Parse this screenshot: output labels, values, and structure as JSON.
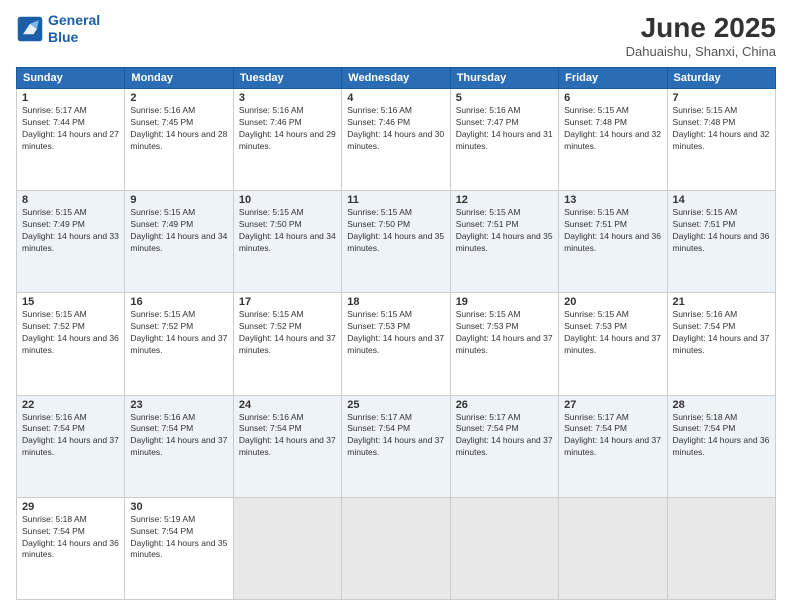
{
  "header": {
    "logo_line1": "General",
    "logo_line2": "Blue",
    "month_title": "June 2025",
    "location": "Dahuaishu, Shanxi, China"
  },
  "days_of_week": [
    "Sunday",
    "Monday",
    "Tuesday",
    "Wednesday",
    "Thursday",
    "Friday",
    "Saturday"
  ],
  "weeks": [
    [
      {
        "day": "1",
        "sunrise": "5:17 AM",
        "sunset": "7:44 PM",
        "daylight": "14 hours and 27 minutes."
      },
      {
        "day": "2",
        "sunrise": "5:16 AM",
        "sunset": "7:45 PM",
        "daylight": "14 hours and 28 minutes."
      },
      {
        "day": "3",
        "sunrise": "5:16 AM",
        "sunset": "7:46 PM",
        "daylight": "14 hours and 29 minutes."
      },
      {
        "day": "4",
        "sunrise": "5:16 AM",
        "sunset": "7:46 PM",
        "daylight": "14 hours and 30 minutes."
      },
      {
        "day": "5",
        "sunrise": "5:16 AM",
        "sunset": "7:47 PM",
        "daylight": "14 hours and 31 minutes."
      },
      {
        "day": "6",
        "sunrise": "5:15 AM",
        "sunset": "7:48 PM",
        "daylight": "14 hours and 32 minutes."
      },
      {
        "day": "7",
        "sunrise": "5:15 AM",
        "sunset": "7:48 PM",
        "daylight": "14 hours and 32 minutes."
      }
    ],
    [
      {
        "day": "8",
        "sunrise": "5:15 AM",
        "sunset": "7:49 PM",
        "daylight": "14 hours and 33 minutes."
      },
      {
        "day": "9",
        "sunrise": "5:15 AM",
        "sunset": "7:49 PM",
        "daylight": "14 hours and 34 minutes."
      },
      {
        "day": "10",
        "sunrise": "5:15 AM",
        "sunset": "7:50 PM",
        "daylight": "14 hours and 34 minutes."
      },
      {
        "day": "11",
        "sunrise": "5:15 AM",
        "sunset": "7:50 PM",
        "daylight": "14 hours and 35 minutes."
      },
      {
        "day": "12",
        "sunrise": "5:15 AM",
        "sunset": "7:51 PM",
        "daylight": "14 hours and 35 minutes."
      },
      {
        "day": "13",
        "sunrise": "5:15 AM",
        "sunset": "7:51 PM",
        "daylight": "14 hours and 36 minutes."
      },
      {
        "day": "14",
        "sunrise": "5:15 AM",
        "sunset": "7:51 PM",
        "daylight": "14 hours and 36 minutes."
      }
    ],
    [
      {
        "day": "15",
        "sunrise": "5:15 AM",
        "sunset": "7:52 PM",
        "daylight": "14 hours and 36 minutes."
      },
      {
        "day": "16",
        "sunrise": "5:15 AM",
        "sunset": "7:52 PM",
        "daylight": "14 hours and 37 minutes."
      },
      {
        "day": "17",
        "sunrise": "5:15 AM",
        "sunset": "7:52 PM",
        "daylight": "14 hours and 37 minutes."
      },
      {
        "day": "18",
        "sunrise": "5:15 AM",
        "sunset": "7:53 PM",
        "daylight": "14 hours and 37 minutes."
      },
      {
        "day": "19",
        "sunrise": "5:15 AM",
        "sunset": "7:53 PM",
        "daylight": "14 hours and 37 minutes."
      },
      {
        "day": "20",
        "sunrise": "5:15 AM",
        "sunset": "7:53 PM",
        "daylight": "14 hours and 37 minutes."
      },
      {
        "day": "21",
        "sunrise": "5:16 AM",
        "sunset": "7:54 PM",
        "daylight": "14 hours and 37 minutes."
      }
    ],
    [
      {
        "day": "22",
        "sunrise": "5:16 AM",
        "sunset": "7:54 PM",
        "daylight": "14 hours and 37 minutes."
      },
      {
        "day": "23",
        "sunrise": "5:16 AM",
        "sunset": "7:54 PM",
        "daylight": "14 hours and 37 minutes."
      },
      {
        "day": "24",
        "sunrise": "5:16 AM",
        "sunset": "7:54 PM",
        "daylight": "14 hours and 37 minutes."
      },
      {
        "day": "25",
        "sunrise": "5:17 AM",
        "sunset": "7:54 PM",
        "daylight": "14 hours and 37 minutes."
      },
      {
        "day": "26",
        "sunrise": "5:17 AM",
        "sunset": "7:54 PM",
        "daylight": "14 hours and 37 minutes."
      },
      {
        "day": "27",
        "sunrise": "5:17 AM",
        "sunset": "7:54 PM",
        "daylight": "14 hours and 37 minutes."
      },
      {
        "day": "28",
        "sunrise": "5:18 AM",
        "sunset": "7:54 PM",
        "daylight": "14 hours and 36 minutes."
      }
    ],
    [
      {
        "day": "29",
        "sunrise": "5:18 AM",
        "sunset": "7:54 PM",
        "daylight": "14 hours and 36 minutes."
      },
      {
        "day": "30",
        "sunrise": "5:19 AM",
        "sunset": "7:54 PM",
        "daylight": "14 hours and 35 minutes."
      },
      {
        "day": "",
        "sunrise": "",
        "sunset": "",
        "daylight": ""
      },
      {
        "day": "",
        "sunrise": "",
        "sunset": "",
        "daylight": ""
      },
      {
        "day": "",
        "sunrise": "",
        "sunset": "",
        "daylight": ""
      },
      {
        "day": "",
        "sunrise": "",
        "sunset": "",
        "daylight": ""
      },
      {
        "day": "",
        "sunrise": "",
        "sunset": "",
        "daylight": ""
      }
    ]
  ]
}
